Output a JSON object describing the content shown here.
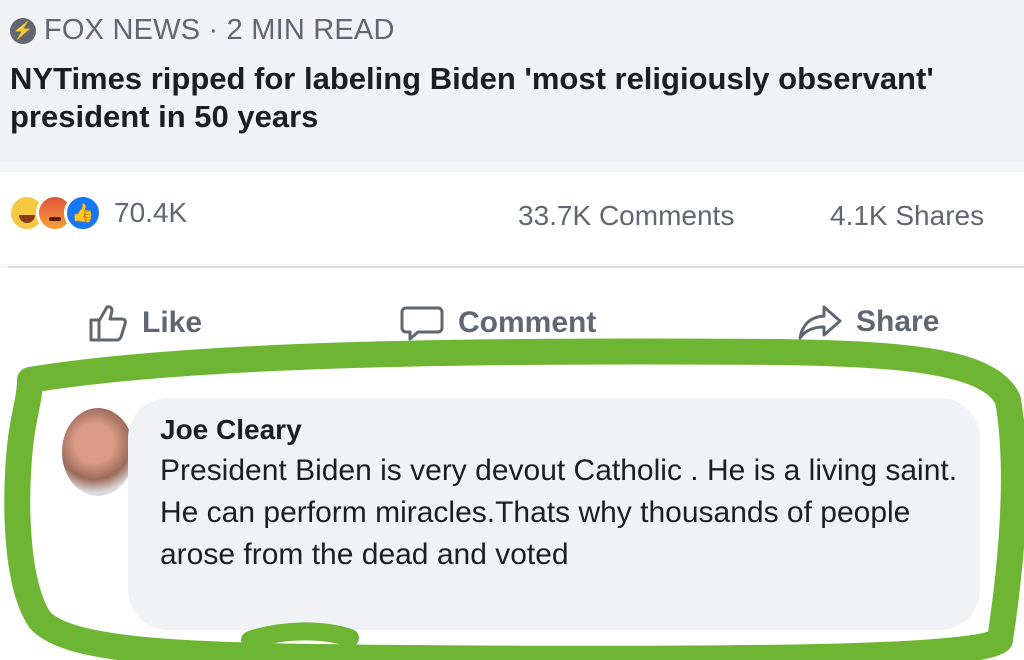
{
  "link": {
    "source": "FOX NEWS · 2 MIN READ",
    "headline": "NYTimes ripped for labeling Biden 'most religiously observant' president in 50 years"
  },
  "stats": {
    "reaction_icons": [
      "haha-icon",
      "angry-icon",
      "like-icon"
    ],
    "reactions": "70.4K",
    "comments": "33.7K Comments",
    "shares": "4.1K Shares"
  },
  "actions": {
    "like": "Like",
    "comment": "Comment",
    "share": "Share"
  },
  "comment": {
    "author": "Joe Cleary",
    "text": "President Biden is very devout Catholic . He is a living saint. He can perform miracles.Thats why thousands of people arose from the dead and voted"
  },
  "colors": {
    "highlight": "#6fb534",
    "like_blue": "#1877f2",
    "muted_text": "#606770"
  }
}
